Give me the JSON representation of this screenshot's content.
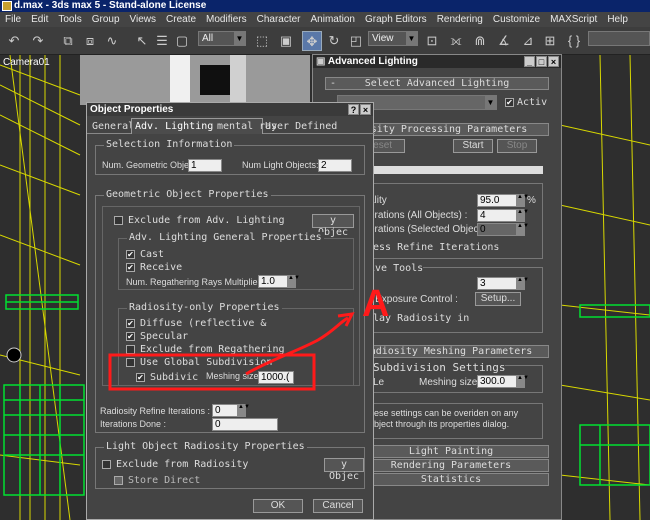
{
  "window": {
    "title": "d.max - 3ds max 5 - Stand-alone License"
  },
  "menu": [
    "File",
    "Edit",
    "Tools",
    "Group",
    "Views",
    "Create",
    "Modifiers",
    "Character",
    "Animation",
    "Graph Editors",
    "Rendering",
    "Customize",
    "MAXScript",
    "Help"
  ],
  "toolbar": {
    "selection_filter": "All",
    "view_coord": "View"
  },
  "viewport": {
    "label": "Camera01"
  },
  "adv": {
    "title": "Advanced Lighting",
    "select_header": "Select Advanced Lighting",
    "active_label": "Activ",
    "process_header": "adiosity Processing Parameters",
    "reset": "Reset",
    "start": "Start",
    "stop": "Stop",
    "quality_label": "ality",
    "quality_value": "95.0",
    "percent": "%",
    "iter_all_label": "erations (All Objects) :",
    "iter_all_value": "4",
    "iter_sel_label": "erations (Selected Objects) :",
    "iter_sel_value": "0",
    "refine_label": "ess Refine Iterations",
    "interactive_header": "ive Tools",
    "tools_value": "3",
    "exposure_label": "r Exposure Control :",
    "setup": "Setup...",
    "display_label": "lay Radiosity in",
    "mesh_header": "adiosity Meshing Parameters",
    "subdiv_header": "Subdivision Settings",
    "le_label": "Le",
    "meshing_label": "Meshing size:",
    "meshing_value": "300.0",
    "note1": "hese settings can be overiden on any",
    "note2": "object through its properties dialog.",
    "light_painting": "Light Painting",
    "render_params": "Rendering Parameters",
    "statistics": "Statistics"
  },
  "obj": {
    "title": "Object Properties",
    "help": "?",
    "close": "×",
    "tabs": [
      "General",
      "Adv. Lighting",
      "mental ray",
      "User Defined"
    ],
    "sel_info_header": "Selection Information",
    "num_geo_label": "Num. Geometric Objects:",
    "num_geo_value": "1",
    "num_light_label": "Num Light Objects:",
    "num_light_value": "2",
    "geo_props_header": "Geometric Object Properties",
    "exclude_label": "Exclude from Adv. Lighting",
    "by_object_btn": "y Objec",
    "gen_props_header": "Adv. Lighting General Properties",
    "cast_label": "Cast",
    "receive_label": "Receive",
    "regather_label": "Num. Regathering Rays Multiplier:",
    "regather_value": "1.0",
    "radio_props_header": "Radiosity-only Properties",
    "diffuse_label": "Diffuse (reflective &",
    "specular_label": "Specular",
    "exclude_regather_label": "Exclude from Regathering",
    "use_global_label": "Use Global Subdivision",
    "subdiv_label": "Subdivic",
    "mesh_size_label": "Meshing size:",
    "mesh_size_value": "1000.(",
    "refine_iter_label": "Radiosity Refine Iterations :",
    "refine_iter_value": "0",
    "iter_done_label": "Iterations Done :",
    "iter_done_value": "0",
    "light_props_header": "Light Object Radiosity Properties",
    "exclude_radio_label": "Exclude from Radiosity",
    "by_object_btn2": "y Objec",
    "store_direct_label": "Store Direct",
    "ok": "OK",
    "cancel": "Cancel"
  },
  "annotation": {
    "letter": "A",
    "color": "#ff1a1a"
  },
  "colors": {
    "accent": "#0a246a",
    "annotation": "#ff1a1a"
  }
}
